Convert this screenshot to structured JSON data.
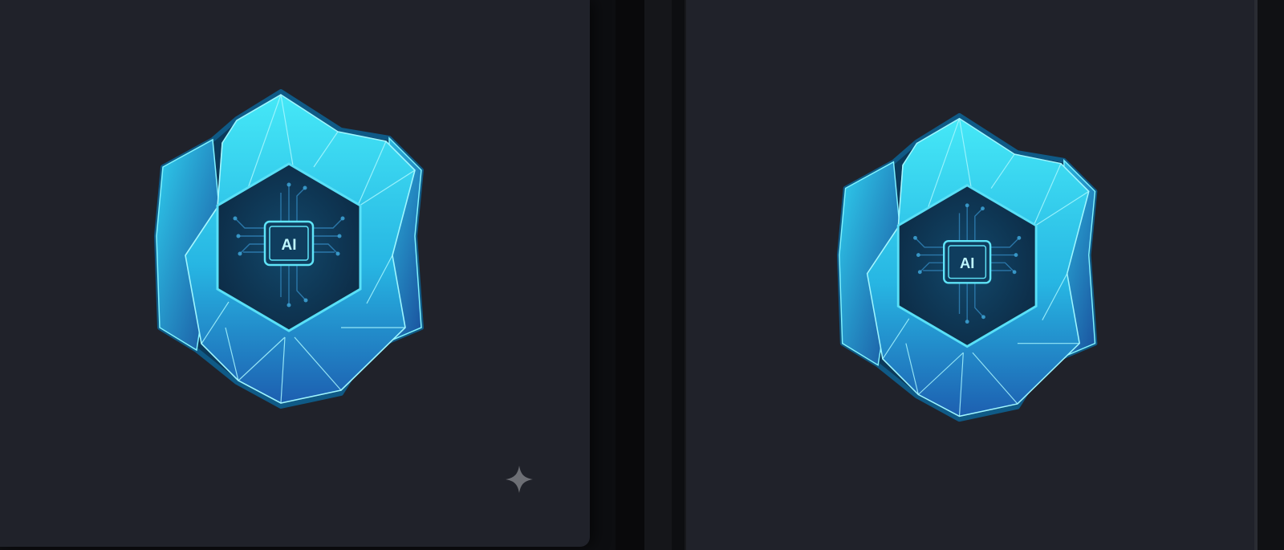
{
  "images": [
    {
      "logo_text": "AI"
    },
    {
      "logo_text": "AI"
    }
  ],
  "icons": {
    "logo": "crystal-hexagon-ai-chip-icon",
    "sparkle": "sparkle-icon"
  },
  "colors": {
    "panel_bg": "#20222a",
    "crystal_light": "#3fe3f5",
    "crystal_mid": "#1fa7d9",
    "crystal_dark": "#1a4f9c",
    "circuit": "#2f7fb3"
  }
}
